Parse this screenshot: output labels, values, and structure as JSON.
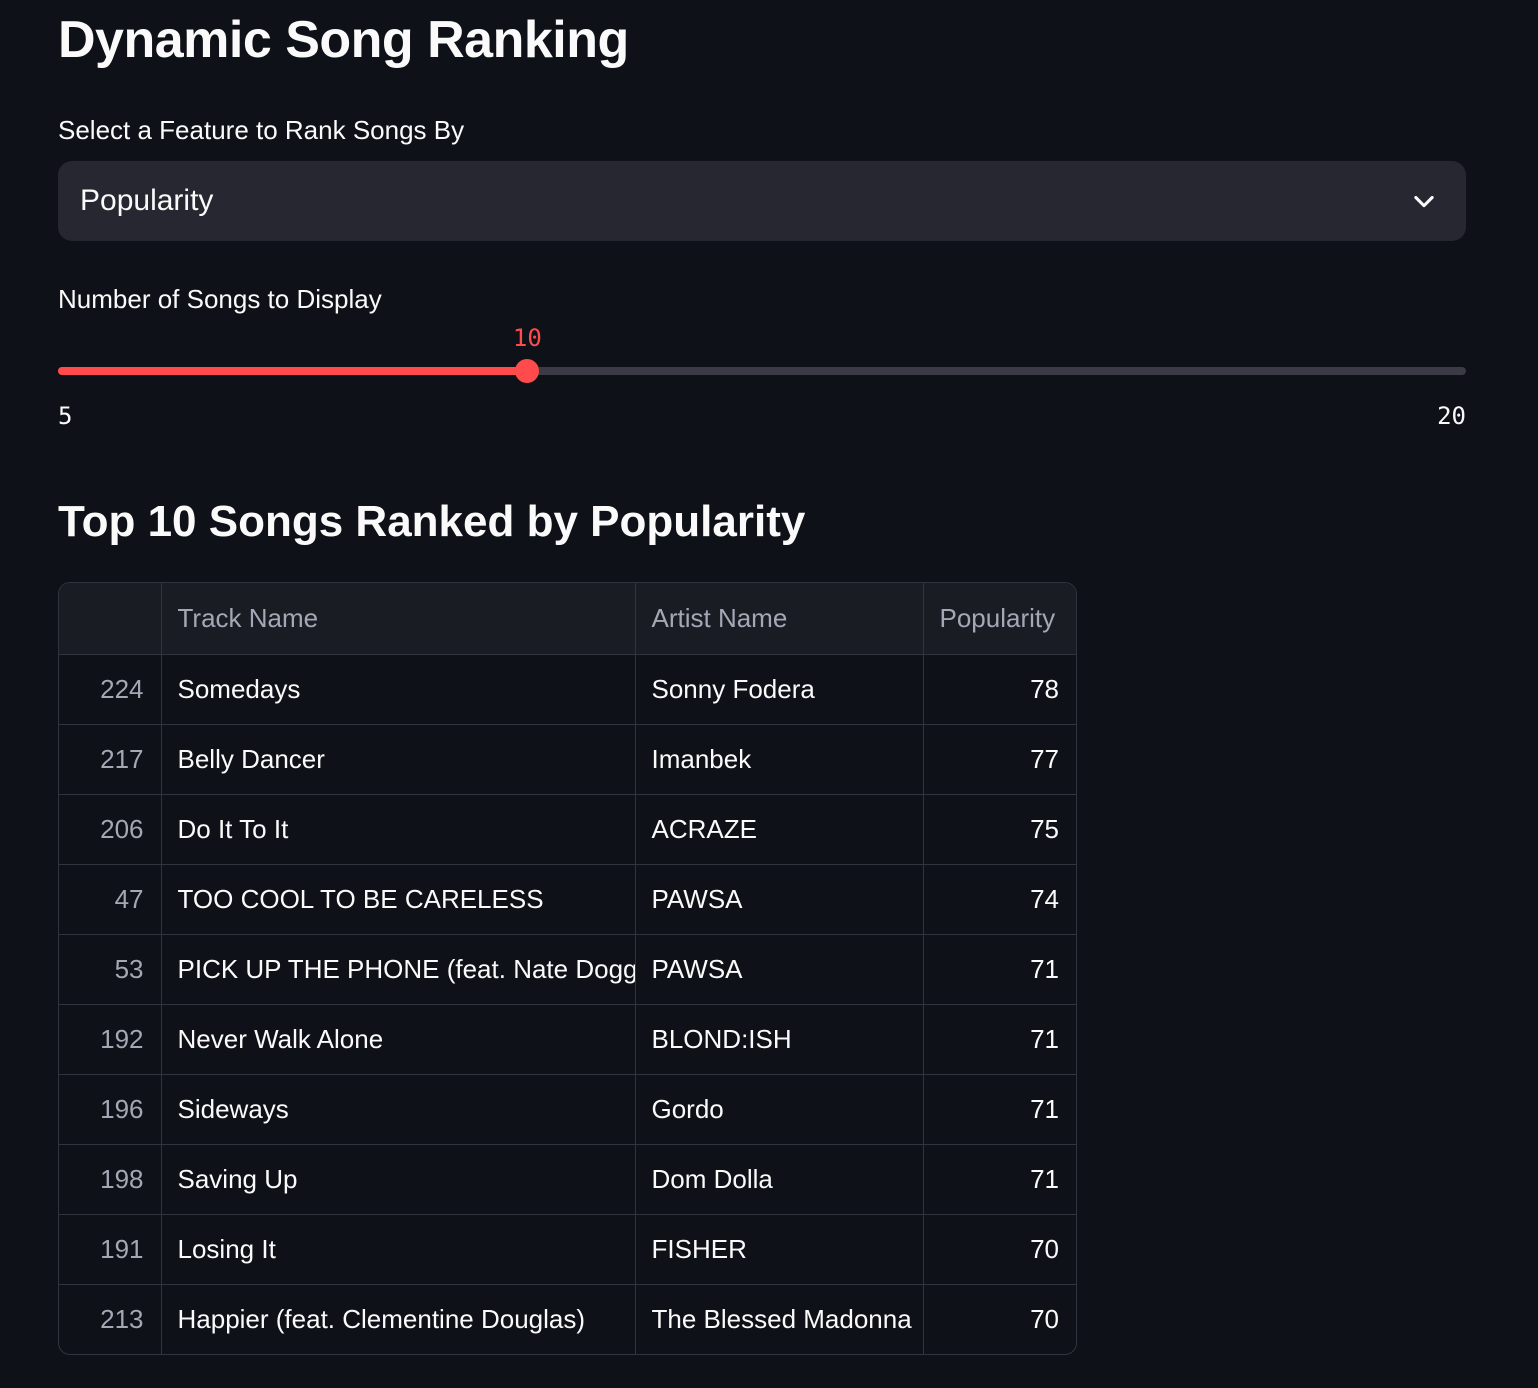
{
  "page": {
    "title": "Dynamic Song Ranking"
  },
  "feature_select": {
    "label": "Select a Feature to Rank Songs By",
    "value": "Popularity"
  },
  "count_slider": {
    "label": "Number of Songs to Display",
    "value": 10,
    "min": 5,
    "max": 20
  },
  "results": {
    "heading": "Top 10 Songs Ranked by Popularity",
    "columns": [
      "",
      "Track Name",
      "Artist Name",
      "Popularity"
    ],
    "rows": [
      {
        "index": "224",
        "track": "Somedays",
        "artist": "Sonny Fodera",
        "popularity": "78"
      },
      {
        "index": "217",
        "track": "Belly Dancer",
        "artist": "Imanbek",
        "popularity": "77"
      },
      {
        "index": "206",
        "track": "Do It To It",
        "artist": "ACRAZE",
        "popularity": "75"
      },
      {
        "index": "47",
        "track": "TOO COOL TO BE CARELESS",
        "artist": "PAWSA",
        "popularity": "74"
      },
      {
        "index": "53",
        "track": "PICK UP THE PHONE (feat. Nate Dogg)",
        "artist": "PAWSA",
        "popularity": "71"
      },
      {
        "index": "192",
        "track": "Never Walk Alone",
        "artist": "BLOND:ISH",
        "popularity": "71"
      },
      {
        "index": "196",
        "track": "Sideways",
        "artist": "Gordo",
        "popularity": "71"
      },
      {
        "index": "198",
        "track": "Saving Up",
        "artist": "Dom Dolla",
        "popularity": "71"
      },
      {
        "index": "191",
        "track": "Losing It",
        "artist": "FISHER",
        "popularity": "70"
      },
      {
        "index": "213",
        "track": "Happier (feat. Clementine Douglas)",
        "artist": "The Blessed Madonna",
        "popularity": "70"
      }
    ]
  },
  "colors": {
    "background": "#0e1117",
    "accent": "#ff4b4b",
    "input_bg": "#262730"
  },
  "icons": {
    "select_chevron": "chevron-down-icon"
  }
}
